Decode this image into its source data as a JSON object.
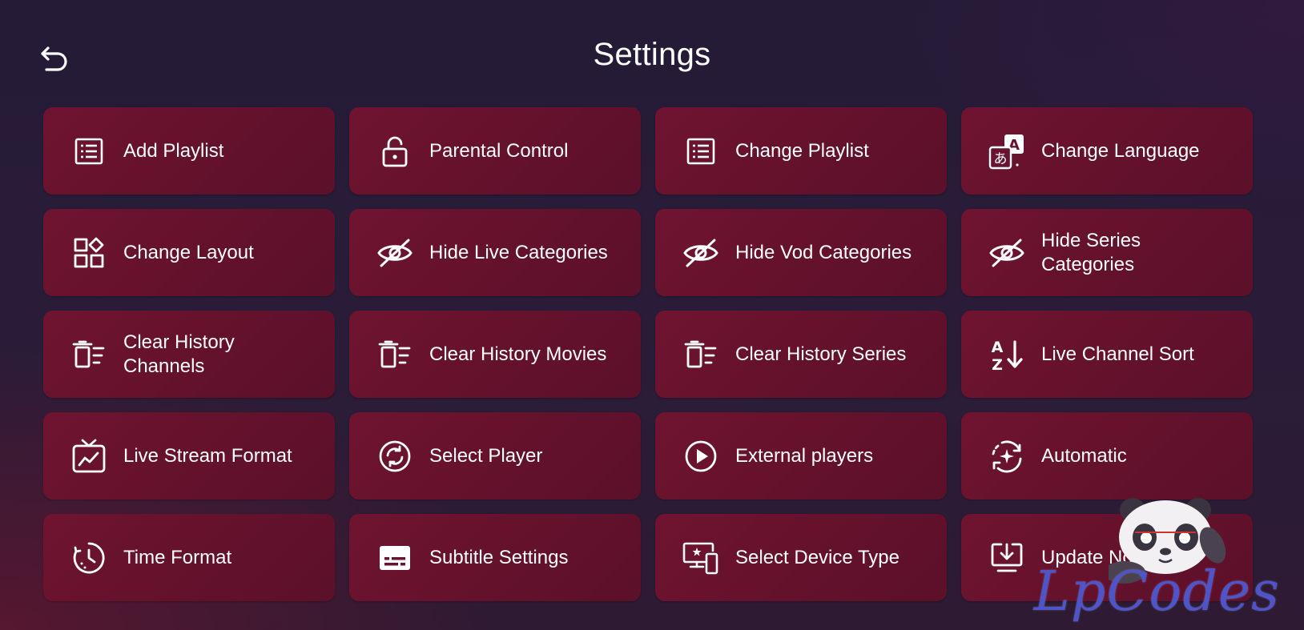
{
  "header": {
    "title": "Settings",
    "back_icon": "undo-arrow-icon"
  },
  "colors": {
    "tile_background": "#6a1330",
    "page_background": "#261b37",
    "text": "#ffffff",
    "watermark_text": "#4d55c9"
  },
  "tiles": [
    {
      "label": "Add Playlist",
      "icon": "list-icon"
    },
    {
      "label": "Parental Control",
      "icon": "lock-icon"
    },
    {
      "label": "Change Playlist",
      "icon": "list-icon"
    },
    {
      "label": "Change Language",
      "icon": "translate-icon"
    },
    {
      "label": "Change Layout",
      "icon": "layout-shapes-icon"
    },
    {
      "label": "Hide Live Categories",
      "icon": "eye-off-icon"
    },
    {
      "label": "Hide Vod Categories",
      "icon": "eye-off-icon"
    },
    {
      "label": "Hide Series Categories",
      "icon": "eye-off-icon"
    },
    {
      "label": "Clear History Channels",
      "icon": "delete-sweep-icon"
    },
    {
      "label": "Clear History Movies",
      "icon": "delete-sweep-icon"
    },
    {
      "label": "Clear History Series",
      "icon": "delete-sweep-icon"
    },
    {
      "label": "Live Channel Sort",
      "icon": "sort-az-icon"
    },
    {
      "label": "Live Stream Format",
      "icon": "tv-chart-icon"
    },
    {
      "label": "Select Player",
      "icon": "player-sync-icon"
    },
    {
      "label": "External players",
      "icon": "play-circle-icon"
    },
    {
      "label": "Automatic",
      "icon": "auto-refresh-icon"
    },
    {
      "label": "Time Format",
      "icon": "clock-icon"
    },
    {
      "label": "Subtitle Settings",
      "icon": "subtitles-icon"
    },
    {
      "label": "Select Device Type",
      "icon": "devices-icon"
    },
    {
      "label": "Update Now",
      "icon": "download-screen-icon"
    }
  ],
  "watermark": {
    "text": "LpCodes",
    "icon": "panda-mascot-icon"
  }
}
